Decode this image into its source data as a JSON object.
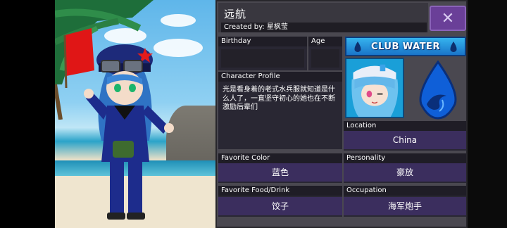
{
  "character": {
    "name": "远航",
    "created_by_label": "Created by:",
    "creator": "星枫莹"
  },
  "fields": {
    "birthday_label": "Birthday",
    "birthday_value": "",
    "age_label": "Age",
    "age_value": "",
    "profile_label": "Character Profile",
    "profile_text": "光是看身着的老式水兵服就知道是什么人了，一直坚守初心的她也在不断激励后辈们",
    "location_label": "Location",
    "location_value": "China",
    "color_label": "Favorite Color",
    "color_value": "蓝色",
    "personality_label": "Personality",
    "personality_value": "豪放",
    "food_label": "Favorite Food/Drink",
    "food_value": "饺子",
    "occupation_label": "Occupation",
    "occupation_value": "海军炮手"
  },
  "club": {
    "name": "CLUB WATER",
    "icon": "water-drop-icon"
  },
  "close_icon": "close-x-icon",
  "colors": {
    "card_bg": "#4a4850",
    "panel_bg": "#292733",
    "value_field": "#3b2e5e",
    "close_button": "#6a3f98",
    "club_blue": "#1a75c9"
  }
}
